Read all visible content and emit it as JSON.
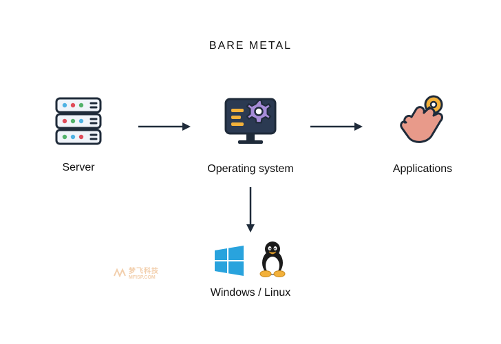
{
  "title": "BARE METAL",
  "nodes": {
    "server": {
      "label": "Server"
    },
    "os": {
      "label": "Operating system"
    },
    "apps": {
      "label": "Applications"
    },
    "os_variants": {
      "label": "Windows / Linux"
    }
  },
  "watermark": {
    "brand": "梦飞科技",
    "sub": "MFISP.COM"
  },
  "chart_data": {
    "type": "flow-diagram",
    "title": "BARE METAL",
    "nodes": [
      {
        "id": "server",
        "label": "Server"
      },
      {
        "id": "os",
        "label": "Operating system"
      },
      {
        "id": "apps",
        "label": "Applications"
      },
      {
        "id": "os_variants",
        "label": "Windows / Linux"
      }
    ],
    "edges": [
      {
        "from": "server",
        "to": "os"
      },
      {
        "from": "os",
        "to": "apps"
      },
      {
        "from": "os",
        "to": "os_variants"
      }
    ]
  }
}
